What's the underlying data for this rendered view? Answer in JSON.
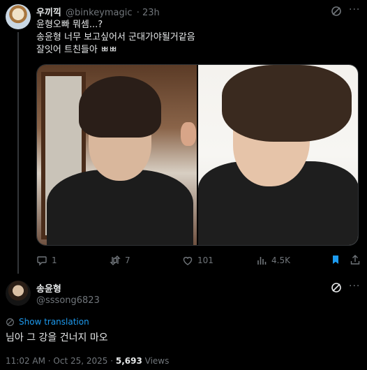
{
  "tweet1": {
    "author_name": "우끼끽",
    "author_handle": "@binkeymagic",
    "time": "· 23h",
    "more_label": "···",
    "lines": [
      "윤형오빠 뭐셈...?",
      "송윤형 너무 보고싶어서 군대가야될거같음",
      "잘잇어 트친들아 ㅃㅃ"
    ],
    "actions": {
      "replies": "1",
      "reposts": "7",
      "likes": "101",
      "views": "4.5K"
    }
  },
  "tweet2": {
    "author_name": "송윤형",
    "author_handle": "@sssong6823",
    "more_label": "···",
    "translate_label": "Show translation",
    "text": "님아 그 강을 건너지 마오",
    "timestamp": "11:02 AM · Oct 25, 2025 · ",
    "views_count": "5,693",
    "views_label": " Views"
  },
  "colors": {
    "background": "#000000",
    "text": "#e7e9ea",
    "muted": "#71767b",
    "accent": "#1d9bf0"
  },
  "icons": [
    "grok-icon",
    "more-icon",
    "reply-icon",
    "repost-icon",
    "like-icon",
    "views-icon",
    "bookmark-icon",
    "share-icon",
    "translate-icon"
  ]
}
